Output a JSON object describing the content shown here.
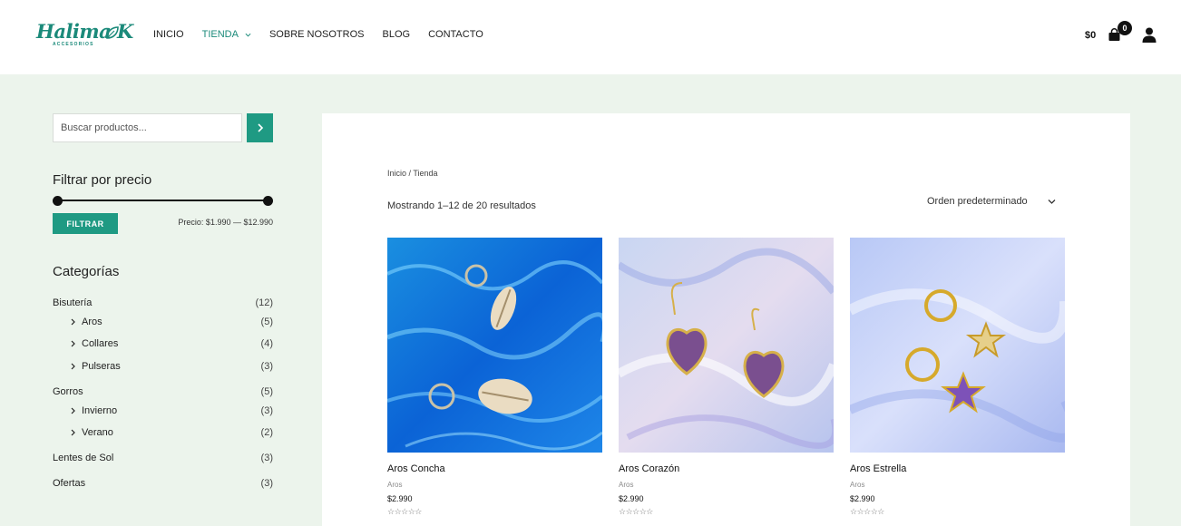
{
  "brand": {
    "logo_text": "Halima K",
    "logo_sub": "ACCESORIOS",
    "accent_color": "#1f9a83"
  },
  "nav": {
    "items": [
      {
        "label": "INICIO"
      },
      {
        "label": "TIENDA",
        "active": true,
        "has_dropdown": true
      },
      {
        "label": "SOBRE NOSOTROS"
      },
      {
        "label": "BLOG"
      },
      {
        "label": "CONTACTO"
      }
    ]
  },
  "cart": {
    "total": "$0",
    "count": "0",
    "icon": "shopping-bag-icon"
  },
  "account": {
    "icon": "user-icon"
  },
  "sidebar": {
    "search": {
      "placeholder": "Buscar productos...",
      "button_icon": "chevron-right-icon"
    },
    "price_filter": {
      "title": "Filtrar por precio",
      "button_label": "FILTRAR",
      "range_text": "Precio: $1.990 — $12.990"
    },
    "categories": {
      "title": "Categorías",
      "items": [
        {
          "label": "Bisutería",
          "count": "(12)"
        },
        {
          "label": "Aros",
          "count": "(5)",
          "sub": true
        },
        {
          "label": "Collares",
          "count": "(4)",
          "sub": true
        },
        {
          "label": "Pulseras",
          "count": "(3)",
          "sub": true
        },
        {
          "label": "Gorros",
          "count": "(5)"
        },
        {
          "label": "Invierno",
          "count": "(3)",
          "sub": true
        },
        {
          "label": "Verano",
          "count": "(2)",
          "sub": true
        },
        {
          "label": "Lentes de Sol",
          "count": "(3)"
        },
        {
          "label": "Ofertas",
          "count": "(3)"
        }
      ]
    }
  },
  "main": {
    "breadcrumb": "Inicio / Tienda",
    "result_count": "Mostrando 1–12 de 20 resultados",
    "orderby": "Orden predeterminado",
    "products": [
      {
        "title": "Aros Concha",
        "category": "Aros",
        "price": "$2.990",
        "stars": "☆☆☆☆☆"
      },
      {
        "title": "Aros Corazón",
        "category": "Aros",
        "price": "$2.990",
        "stars": "☆☆☆☆☆"
      },
      {
        "title": "Aros Estrella",
        "category": "Aros",
        "price": "$2.990",
        "stars": "☆☆☆☆☆"
      }
    ]
  }
}
